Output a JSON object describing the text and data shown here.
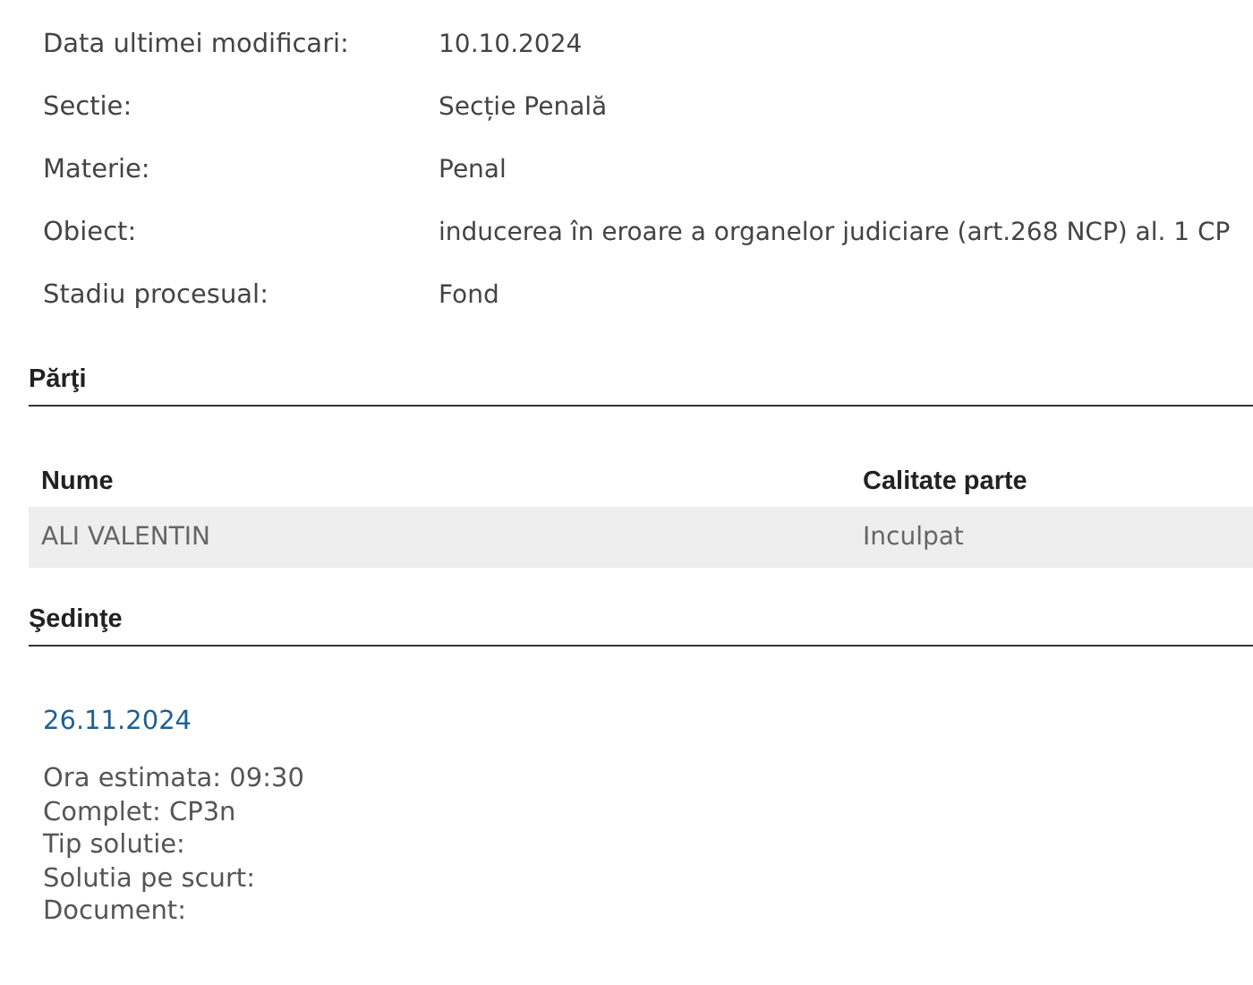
{
  "details": [
    {
      "label": "Data ultimei modificari:",
      "value": "10.10.2024"
    },
    {
      "label": "Sectie:",
      "value": "Secție Penală"
    },
    {
      "label": "Materie:",
      "value": "Penal"
    },
    {
      "label": "Obiect:",
      "value": "inducerea în eroare a organelor judiciare (art.268 NCP) al. 1 CP"
    },
    {
      "label": "Stadiu procesual:",
      "value": "Fond"
    }
  ],
  "parties": {
    "title": "Părţi",
    "columns": [
      "Nume",
      "Calitate parte"
    ],
    "rows": [
      [
        "ALI VALENTIN",
        "Inculpat"
      ]
    ]
  },
  "hearings": {
    "title": "Şedinţe",
    "items": [
      {
        "date": "26.11.2024",
        "lines": [
          "Ora estimata: 09:30",
          "Complet: CP3n",
          "Tip solutie:",
          "Solutia pe scurt:",
          "Document:"
        ]
      }
    ]
  }
}
